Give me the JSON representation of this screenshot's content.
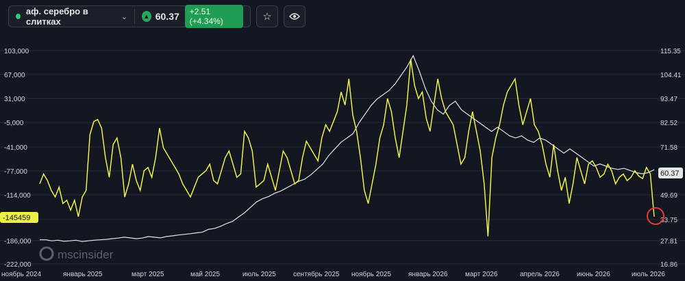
{
  "toolbar": {
    "instrument": "аф. серебро в слитках",
    "price": "60.37",
    "change": "+2.51 (+4.34%)",
    "icons": [
      "status-dot",
      "chevron-down-icon",
      "up-triangle-icon",
      "star-icon",
      "eye-icon"
    ]
  },
  "watermark": {
    "text": "mscinsider"
  },
  "colors": {
    "background": "#131722",
    "yellow_series": "#f0f04a",
    "white_series": "#e6e6e6",
    "highlight": "#e53935"
  },
  "chart_data": {
    "type": "line",
    "x_ticks": [
      "ноябрь 2024",
      "январь 2025",
      "март 2025",
      "май 2025",
      "июль 2025",
      "сентябрь 2025",
      "ноябрь 2025",
      "январь 2026",
      "март 2026",
      "апрель 2026",
      "июнь 2026",
      "июль 2026"
    ],
    "left_axis": {
      "ticks": [
        "103,000",
        "67,000",
        "31,000",
        "-5,000",
        "-41,000",
        "-77,000",
        "-114,000",
        "-186,000",
        "-222,000"
      ],
      "range": [
        -222000,
        103000
      ],
      "current_label": "-145459"
    },
    "right_axis": {
      "ticks": [
        "115.35",
        "104.41",
        "93.47",
        "82.52",
        "71.58",
        "49.69",
        "33.75",
        "27.81",
        "16.86"
      ],
      "range": [
        16.86,
        115.35
      ],
      "current_label": "60.37"
    },
    "series": [
      {
        "axis": "left",
        "color": "#f0f04a",
        "values": [
          -100000,
          -85000,
          -95000,
          -110000,
          -120000,
          -105000,
          -130000,
          -125000,
          -140000,
          -125000,
          -150000,
          -120000,
          -110000,
          -25000,
          -5000,
          -2000,
          -15000,
          -60000,
          -90000,
          -40000,
          -30000,
          -60000,
          -120000,
          -100000,
          -70000,
          -95000,
          -110000,
          -80000,
          -75000,
          -90000,
          -60000,
          -15000,
          -45000,
          -55000,
          -65000,
          -75000,
          -85000,
          -100000,
          -110000,
          -120000,
          -105000,
          -90000,
          -85000,
          -80000,
          -70000,
          -95000,
          -100000,
          -80000,
          -60000,
          -50000,
          -70000,
          -90000,
          -85000,
          -20000,
          -30000,
          -50000,
          -105000,
          -100000,
          -95000,
          -70000,
          -90000,
          -110000,
          -80000,
          -50000,
          -60000,
          -80000,
          -100000,
          -95000,
          -60000,
          -35000,
          -45000,
          -55000,
          -65000,
          -30000,
          -10000,
          -20000,
          -5000,
          10000,
          40000,
          20000,
          60000,
          5000,
          -20000,
          -60000,
          -110000,
          -130000,
          -100000,
          -70000,
          -30000,
          -10000,
          30000,
          10000,
          -30000,
          -60000,
          -20000,
          20000,
          90000,
          50000,
          30000,
          40000,
          0,
          -20000,
          20000,
          60000,
          30000,
          10000,
          0,
          -10000,
          -40000,
          -70000,
          -60000,
          -20000,
          10000,
          -20000,
          -50000,
          -100000,
          -180000,
          -60000,
          -30000,
          -10000,
          20000,
          40000,
          50000,
          60000,
          20000,
          -10000,
          10000,
          30000,
          -10000,
          -20000,
          -40000,
          -70000,
          -90000,
          -40000,
          -80000,
          -110000,
          -90000,
          -130000,
          -100000,
          -60000,
          -80000,
          -100000,
          -70000,
          -65000,
          -75000,
          -90000,
          -85000,
          -70000,
          -80000,
          -100000,
          -90000,
          -85000,
          -95000,
          -90000,
          -80000,
          -88000,
          -92000,
          -75000,
          -85000,
          -150000
        ]
      },
      {
        "axis": "right",
        "color": "#e6e6e6",
        "values": [
          28,
          28,
          27.5,
          27.8,
          27.3,
          27.5,
          27.8,
          27.2,
          27.5,
          27.8,
          28,
          28.2,
          28.5,
          28.8,
          29.2,
          28.9,
          28.5,
          28.8,
          29.5,
          29.2,
          28.9,
          29.5,
          29.8,
          30.2,
          30.5,
          30.8,
          31.2,
          31.5,
          32.8,
          33.2,
          34.2,
          35.5,
          36.5,
          38.5,
          40.5,
          43,
          45.5,
          47,
          48,
          49.5,
          50.5,
          52,
          53.5,
          55,
          56,
          58,
          60.5,
          63,
          67,
          70,
          73,
          75,
          77,
          82,
          86,
          90,
          93,
          95,
          97,
          100,
          104,
          108,
          113,
          106,
          98,
          92,
          88,
          86,
          90,
          92,
          88,
          86,
          84,
          82,
          80,
          78,
          80,
          78,
          76,
          75,
          76,
          74,
          73,
          75,
          74,
          72,
          70,
          68,
          70,
          68,
          66,
          64,
          62,
          63,
          62,
          61,
          60.5,
          61,
          60,
          59,
          58.5,
          59,
          60.37
        ]
      }
    ]
  }
}
